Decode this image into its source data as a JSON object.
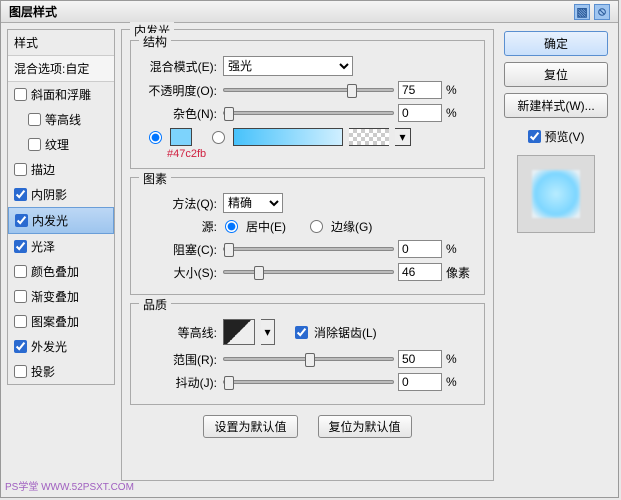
{
  "title": "图层样式",
  "left": {
    "styles_label": "样式",
    "blend_label": "混合选项:自定",
    "items": [
      {
        "label": "斜面和浮雕",
        "checked": false,
        "indent": false
      },
      {
        "label": "等高线",
        "checked": false,
        "indent": true
      },
      {
        "label": "纹理",
        "checked": false,
        "indent": true
      },
      {
        "label": "描边",
        "checked": false,
        "indent": false
      },
      {
        "label": "内阴影",
        "checked": true,
        "indent": false
      },
      {
        "label": "内发光",
        "checked": true,
        "indent": false,
        "selected": true
      },
      {
        "label": "光泽",
        "checked": true,
        "indent": false
      },
      {
        "label": "颜色叠加",
        "checked": false,
        "indent": false
      },
      {
        "label": "渐变叠加",
        "checked": false,
        "indent": false
      },
      {
        "label": "图案叠加",
        "checked": false,
        "indent": false
      },
      {
        "label": "外发光",
        "checked": true,
        "indent": false
      },
      {
        "label": "投影",
        "checked": false,
        "indent": false
      }
    ]
  },
  "center": {
    "section_title": "内发光",
    "struct_title": "结构",
    "blend_mode_label": "混合模式(E):",
    "blend_mode_value": "强光",
    "opacity_label": "不透明度(O):",
    "opacity_value": "75",
    "opacity_unit": "%",
    "noise_label": "杂色(N):",
    "noise_value": "0",
    "noise_unit": "%",
    "color_hex": "#47c2fb",
    "elements_title": "图素",
    "technique_label": "方法(Q):",
    "technique_value": "精确",
    "source_label": "源:",
    "source_center": "居中(E)",
    "source_edge": "边缘(G)",
    "choke_label": "阻塞(C):",
    "choke_value": "0",
    "choke_unit": "%",
    "size_label": "大小(S):",
    "size_value": "46",
    "size_unit": "像素",
    "quality_title": "品质",
    "contour_label": "等高线:",
    "antialias_label": "消除锯齿(L)",
    "range_label": "范围(R):",
    "range_value": "50",
    "range_unit": "%",
    "jitter_label": "抖动(J):",
    "jitter_value": "0",
    "jitter_unit": "%",
    "make_default": "设置为默认值",
    "reset_default": "复位为默认值"
  },
  "right": {
    "ok": "确定",
    "cancel": "复位",
    "new_style": "新建样式(W)...",
    "preview": "预览(V)"
  },
  "watermark": "PS学堂 WWW.52PSXT.COM"
}
